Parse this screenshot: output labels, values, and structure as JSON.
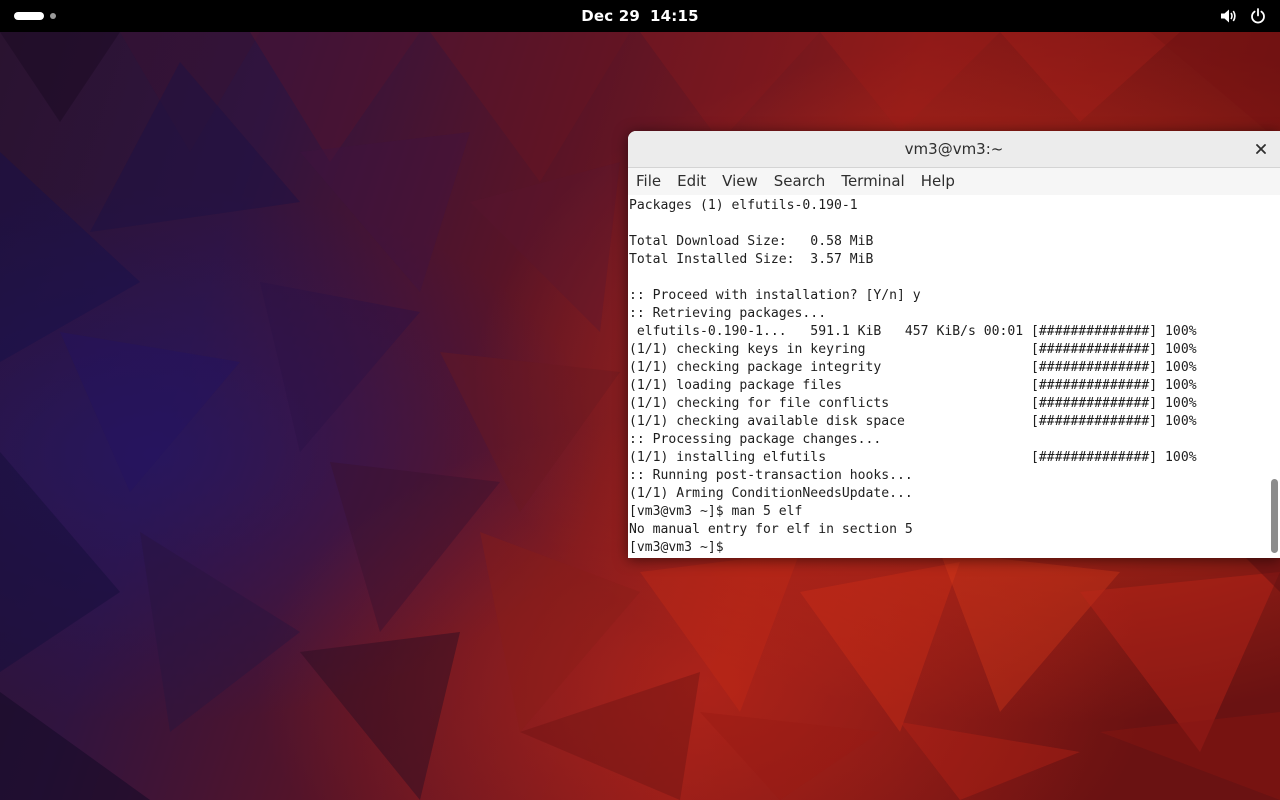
{
  "topbar": {
    "date": "Dec 29",
    "time": "14:15",
    "tray_icons": [
      "volume-icon",
      "power-icon"
    ]
  },
  "terminal": {
    "title": "vm3@vm3:~",
    "menu": [
      "File",
      "Edit",
      "View",
      "Search",
      "Terminal",
      "Help"
    ],
    "lines": [
      "Packages (1) elfutils-0.190-1",
      "",
      "Total Download Size:   0.58 MiB",
      "Total Installed Size:  3.57 MiB",
      "",
      ":: Proceed with installation? [Y/n] y",
      ":: Retrieving packages...",
      " elfutils-0.190-1...   591.1 KiB   457 KiB/s 00:01 [##############] 100%",
      "(1/1) checking keys in keyring                     [##############] 100%",
      "(1/1) checking package integrity                   [##############] 100%",
      "(1/1) loading package files                        [##############] 100%",
      "(1/1) checking for file conflicts                  [##############] 100%",
      "(1/1) checking available disk space                [##############] 100%",
      ":: Processing package changes...",
      "(1/1) installing elfutils                          [##############] 100%",
      ":: Running post-transaction hooks...",
      "(1/1) Arming ConditionNeedsUpdate...",
      "[vm3@vm3 ~]$ man 5 elf",
      "No manual entry for elf in section 5",
      "[vm3@vm3 ~]$ "
    ]
  },
  "colors": {
    "topbar_bg": "#000000",
    "terminal_bg": "#ffffff",
    "terminal_text": "#1e1e1e",
    "titlebar_bg": "#ececec"
  }
}
